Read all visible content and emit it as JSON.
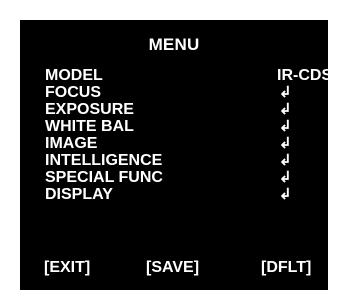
{
  "menu": {
    "title": "MENU",
    "items": [
      {
        "label": "MODEL",
        "value": "IR-CDS"
      },
      {
        "label": "FOCUS",
        "value": "↲"
      },
      {
        "label": "EXPOSURE",
        "value": "↲"
      },
      {
        "label": "WHITE BAL",
        "value": "↲"
      },
      {
        "label": "IMAGE",
        "value": "↲"
      },
      {
        "label": "INTELLIGENCE",
        "value": "↲"
      },
      {
        "label": "SPECIAL FUNC",
        "value": "↲"
      },
      {
        "label": "DISPLAY",
        "value": "↲"
      }
    ]
  },
  "footer": {
    "exit": "[EXIT]",
    "save": "[SAVE]",
    "dflt": "[DFLT]"
  },
  "colors": {
    "background": "#000000",
    "text": "#ffffff"
  },
  "icons": {
    "enter": "enter-arrow-icon"
  }
}
